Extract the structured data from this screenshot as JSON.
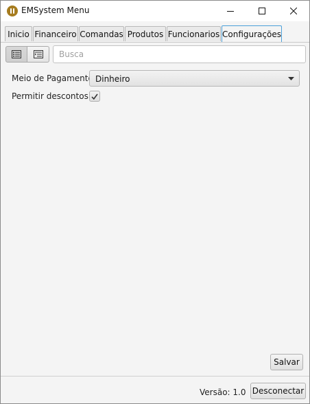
{
  "window": {
    "title": "EMSystem Menu",
    "icon": "fork-knife-icon",
    "controls": [
      "minimize",
      "maximize",
      "close"
    ]
  },
  "tabs": [
    {
      "label": "Inicio",
      "active": false
    },
    {
      "label": "Financeiro",
      "active": false
    },
    {
      "label": "Comandas",
      "active": false
    },
    {
      "label": "Produtos",
      "active": false
    },
    {
      "label": "Funcionarios",
      "active": false
    },
    {
      "label": "Configurações",
      "active": true
    }
  ],
  "toolbar": {
    "list_view_icon": "list-view-icon",
    "detail_view_icon": "detail-view-icon",
    "search_placeholder": "Busca",
    "search_value": ""
  },
  "settings": {
    "payment_label": "Meio de Pagamento",
    "payment_value": "Dinheiro",
    "discount_label": "Permitir descontos",
    "discount_checked": true
  },
  "actions": {
    "save_label": "Salvar"
  },
  "footer": {
    "version_text": "Versão: 1.0",
    "disconnect_label": "Desconectar"
  },
  "colors": {
    "active_tab_border": "#4a9fd9",
    "app_icon": "#a67c1f"
  }
}
